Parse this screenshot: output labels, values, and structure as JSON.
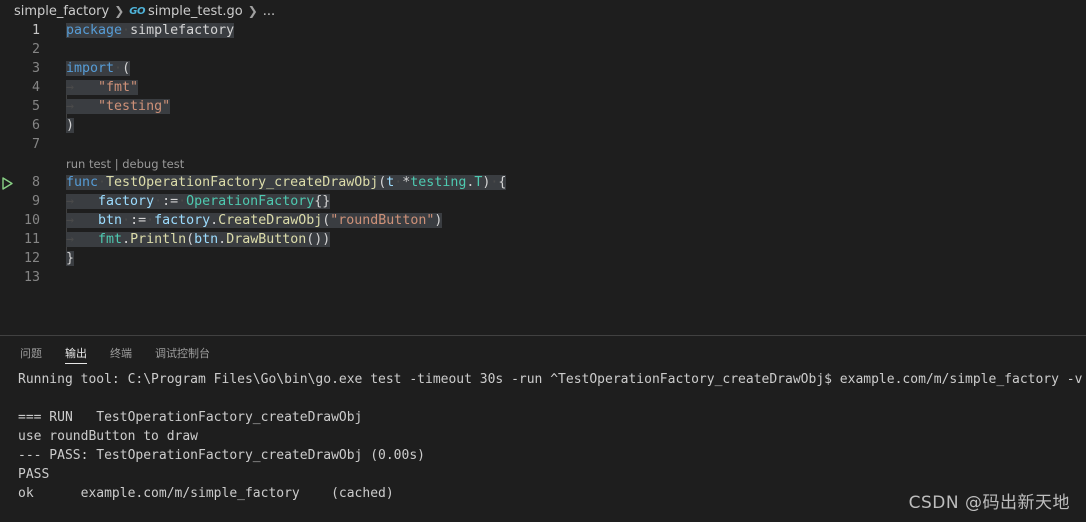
{
  "breadcrumb": {
    "folder": "simple_factory",
    "file_icon": "GO",
    "file": "simple_test.go",
    "more": "..."
  },
  "editor": {
    "codelens": {
      "run": "run test",
      "sep": " | ",
      "debug": "debug test"
    },
    "lines": [
      {
        "n": "1",
        "tokens": [
          [
            "kw",
            "package"
          ],
          [
            "ws",
            "·"
          ],
          [
            "txt",
            "simplefactory"
          ]
        ]
      },
      {
        "n": "2",
        "tokens": []
      },
      {
        "n": "3",
        "tokens": [
          [
            "kw",
            "import"
          ],
          [
            "ws",
            "·"
          ],
          [
            "txt",
            "("
          ]
        ]
      },
      {
        "n": "4",
        "tokens": [
          [
            "ws",
            "→   "
          ],
          [
            "str",
            "\"fmt\""
          ]
        ]
      },
      {
        "n": "5",
        "tokens": [
          [
            "ws",
            "→   "
          ],
          [
            "str",
            "\"testing\""
          ]
        ]
      },
      {
        "n": "6",
        "tokens": [
          [
            "txt",
            ")"
          ]
        ]
      },
      {
        "n": "7",
        "tokens": []
      },
      {
        "n": "8",
        "tokens": [
          [
            "kw",
            "func"
          ],
          [
            "ws",
            "·"
          ],
          [
            "fn",
            "TestOperationFactory_createDrawObj"
          ],
          [
            "txt",
            "("
          ],
          [
            "var",
            "t"
          ],
          [
            "ws",
            "·"
          ],
          [
            "txt",
            "*"
          ],
          [
            "typ",
            "testing"
          ],
          [
            "txt",
            "."
          ],
          [
            "typ",
            "T"
          ],
          [
            "txt",
            ")"
          ],
          [
            "ws",
            "·"
          ],
          [
            "txt",
            "{"
          ]
        ]
      },
      {
        "n": "9",
        "tokens": [
          [
            "ws",
            "→   "
          ],
          [
            "var",
            "factory"
          ],
          [
            "ws",
            "·"
          ],
          [
            "txt",
            ":="
          ],
          [
            "ws",
            "·"
          ],
          [
            "typ",
            "OperationFactory"
          ],
          [
            "txt",
            "{}"
          ]
        ]
      },
      {
        "n": "10",
        "tokens": [
          [
            "ws",
            "→   "
          ],
          [
            "var",
            "btn"
          ],
          [
            "ws",
            "·"
          ],
          [
            "txt",
            ":="
          ],
          [
            "ws",
            "·"
          ],
          [
            "var",
            "factory"
          ],
          [
            "txt",
            "."
          ],
          [
            "fn",
            "CreateDrawObj"
          ],
          [
            "txt",
            "("
          ],
          [
            "str",
            "\"roundButton\""
          ],
          [
            "txt",
            ")"
          ]
        ]
      },
      {
        "n": "11",
        "tokens": [
          [
            "ws",
            "→   "
          ],
          [
            "typ",
            "fmt"
          ],
          [
            "txt",
            "."
          ],
          [
            "fn",
            "Println"
          ],
          [
            "txt",
            "("
          ],
          [
            "var",
            "btn"
          ],
          [
            "txt",
            "."
          ],
          [
            "fn",
            "DrawButton"
          ],
          [
            "txt",
            "())"
          ]
        ]
      },
      {
        "n": "12",
        "tokens": [
          [
            "txt",
            "}"
          ]
        ]
      },
      {
        "n": "13",
        "tokens": []
      }
    ]
  },
  "panel": {
    "tabs": [
      "问题",
      "输出",
      "终端",
      "调试控制台"
    ],
    "active_tab": "输出",
    "output": [
      "Running tool: C:\\Program Files\\Go\\bin\\go.exe test -timeout 30s -run ^TestOperationFactory_createDrawObj$ example.com/m/simple_factory -v",
      "",
      "=== RUN   TestOperationFactory_createDrawObj",
      "use roundButton to draw",
      "--- PASS: TestOperationFactory_createDrawObj (0.00s)",
      "PASS",
      "ok      example.com/m/simple_factory    (cached)"
    ]
  },
  "watermark": "CSDN @码出新天地",
  "colors": {
    "background": "#1e1e1e",
    "keyword": "#569cd6",
    "string": "#ce9178",
    "function": "#dcdcaa",
    "variable": "#9cdcfe",
    "type": "#4ec9b0",
    "selection": "#3a3d41",
    "run_icon": "#89d185"
  }
}
